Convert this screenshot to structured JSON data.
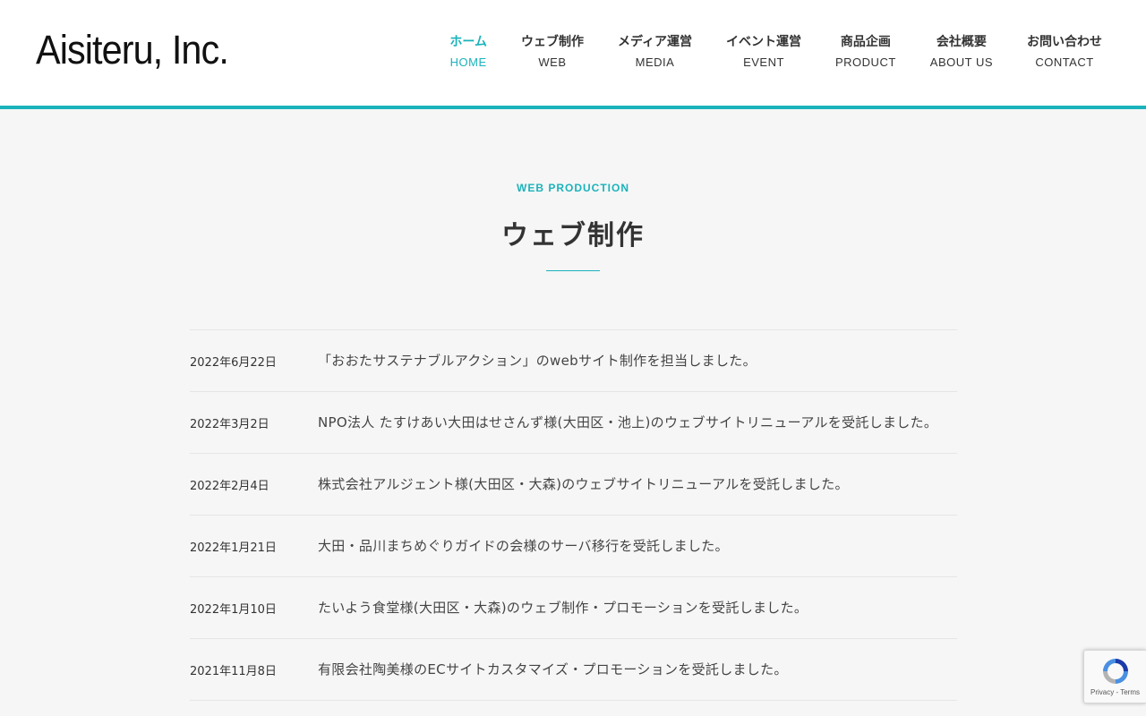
{
  "header": {
    "logo_text": "Aisiteru, Inc.",
    "nav": [
      {
        "ja": "ホーム",
        "en": "HOME",
        "active": true
      },
      {
        "ja": "ウェブ制作",
        "en": "WEB"
      },
      {
        "ja": "メディア運営",
        "en": "MEDIA"
      },
      {
        "ja": "イベント運営",
        "en": "EVENT"
      },
      {
        "ja": "商品企画",
        "en": "PRODUCT"
      },
      {
        "ja": "会社概要",
        "en": "ABOUT US"
      },
      {
        "ja": "お問い合わせ",
        "en": "CONTACT"
      }
    ]
  },
  "section": {
    "label": "WEB PRODUCTION",
    "title": "ウェブ制作"
  },
  "news": [
    {
      "date": "2022年6月22日",
      "text": "「おおたサステナブルアクション」のwebサイト制作を担当しました。"
    },
    {
      "date": "2022年3月2日",
      "text": "NPO法人 たすけあい大田はせさんず様(大田区・池上)のウェブサイトリニューアルを受託しました。"
    },
    {
      "date": "2022年2月4日",
      "text": "株式会社アルジェント様(大田区・大森)のウェブサイトリニューアルを受託しました。"
    },
    {
      "date": "2022年1月21日",
      "text": "大田・品川まちめぐりガイドの会様のサーバ移行を受託しました。"
    },
    {
      "date": "2022年1月10日",
      "text": "たいよう食堂様(大田区・大森)のウェブ制作・プロモーションを受託しました。"
    },
    {
      "date": "2021年11月8日",
      "text": "有限会社陶美様のECサイトカスタマイズ・プロモーションを受託しました。"
    }
  ],
  "recaptcha": {
    "links": "Privacy - Terms",
    "icon": "recaptcha-icon"
  },
  "colors": {
    "accent": "#1bb3bb",
    "background": "#f6f6f6"
  }
}
